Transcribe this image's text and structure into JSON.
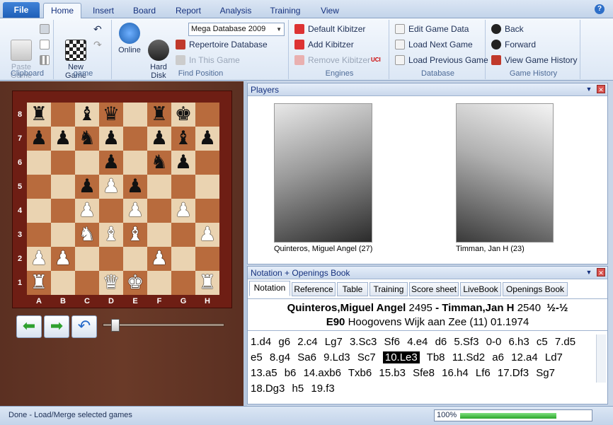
{
  "app": {
    "file_label": "File",
    "help": "?"
  },
  "tabs": [
    {
      "label": "Home",
      "active": true
    },
    {
      "label": "Insert"
    },
    {
      "label": "Board"
    },
    {
      "label": "Report"
    },
    {
      "label": "Analysis"
    },
    {
      "label": "Training"
    },
    {
      "label": "View"
    }
  ],
  "ribbon": {
    "clipboard": {
      "paste": "Paste\nGame",
      "label": "Clipboard"
    },
    "game": {
      "new_game": "New\nGame",
      "label": "game"
    },
    "find": {
      "online": "Online",
      "hard_disk": "Hard\nDisk",
      "database_selected": "Mega Database 2009",
      "repertoire": "Repertoire Database",
      "in_this_game": "In This Game",
      "label": "Find Position"
    },
    "engines": {
      "default": "Default Kibitzer",
      "add": "Add Kibitzer",
      "remove": "Remove Kibitzer",
      "uci": "UCI",
      "label": "Engines"
    },
    "database": {
      "edit": "Edit Game Data",
      "next": "Load Next Game",
      "prev": "Load Previous Game",
      "label": "Database"
    },
    "history": {
      "back": "Back",
      "forward": "Forward",
      "view": "View Game History",
      "label": "Game History"
    }
  },
  "board": {
    "ranks": [
      "8",
      "7",
      "6",
      "5",
      "4",
      "3",
      "2",
      "1"
    ],
    "files": [
      "A",
      "B",
      "C",
      "D",
      "E",
      "F",
      "G",
      "H"
    ],
    "rows": [
      [
        "bR",
        "",
        "bB",
        "bQ",
        "",
        "bR",
        "bK",
        ""
      ],
      [
        "bP",
        "bP",
        "bN",
        "bP",
        "",
        "bP",
        "bB",
        "bP"
      ],
      [
        "",
        "",
        "",
        "bP",
        "",
        "bN",
        "bP",
        ""
      ],
      [
        "",
        "",
        "bP",
        "wP",
        "bP",
        "",
        "",
        ""
      ],
      [
        "",
        "",
        "wP",
        "",
        "wP",
        "",
        "wP",
        ""
      ],
      [
        "",
        "",
        "wN",
        "wB",
        "wB",
        "",
        "",
        "wP"
      ],
      [
        "wP",
        "wP",
        "",
        "",
        "",
        "wP",
        "",
        ""
      ],
      [
        "wR",
        "",
        "",
        "wQ",
        "wK",
        "",
        "",
        "wR"
      ]
    ]
  },
  "players": {
    "title": "Players",
    "white": {
      "name": "Quinteros, Miguel Angel",
      "elo_note": "(27)"
    },
    "black": {
      "name": "Timman, Jan H",
      "elo_note": "(23)"
    }
  },
  "notation": {
    "title": "Notation + Openings Book",
    "tabs": [
      "Notation",
      "Reference",
      "Table",
      "Training",
      "Score sheet",
      "LiveBook",
      "Openings Book"
    ],
    "header_white": "Quinteros,Miguel Angel",
    "white_elo": "2495",
    "dash": "-",
    "header_black": "Timman,Jan H",
    "black_elo": "2540",
    "result": "½-½",
    "eco": "E90",
    "event": "Hoogovens Wijk aan Zee (11) 01.1974",
    "moves": [
      "1.d4",
      "g6",
      "2.c4",
      "Lg7",
      "3.Sc3",
      "Sf6",
      "4.e4",
      "d6",
      "5.Sf3",
      "0-0",
      "6.h3",
      "c5",
      "7.d5",
      "e5",
      "8.g4",
      "Sa6",
      "9.Ld3",
      "Sc7",
      "10.Le3",
      "Tb8",
      "11.Sd2",
      "a6",
      "12.a4",
      "Ld7",
      "13.a5",
      "b6",
      "14.axb6",
      "Txb6",
      "15.b3",
      "Sfe8",
      "16.h4",
      "Lf6",
      "17.Df3",
      "Sg7",
      "18.Dg3",
      "h5",
      "19.f3"
    ],
    "current_index": 18
  },
  "status": {
    "text": "Done - Load/Merge selected games",
    "progress": "100%",
    "progress_value": 1.0
  }
}
